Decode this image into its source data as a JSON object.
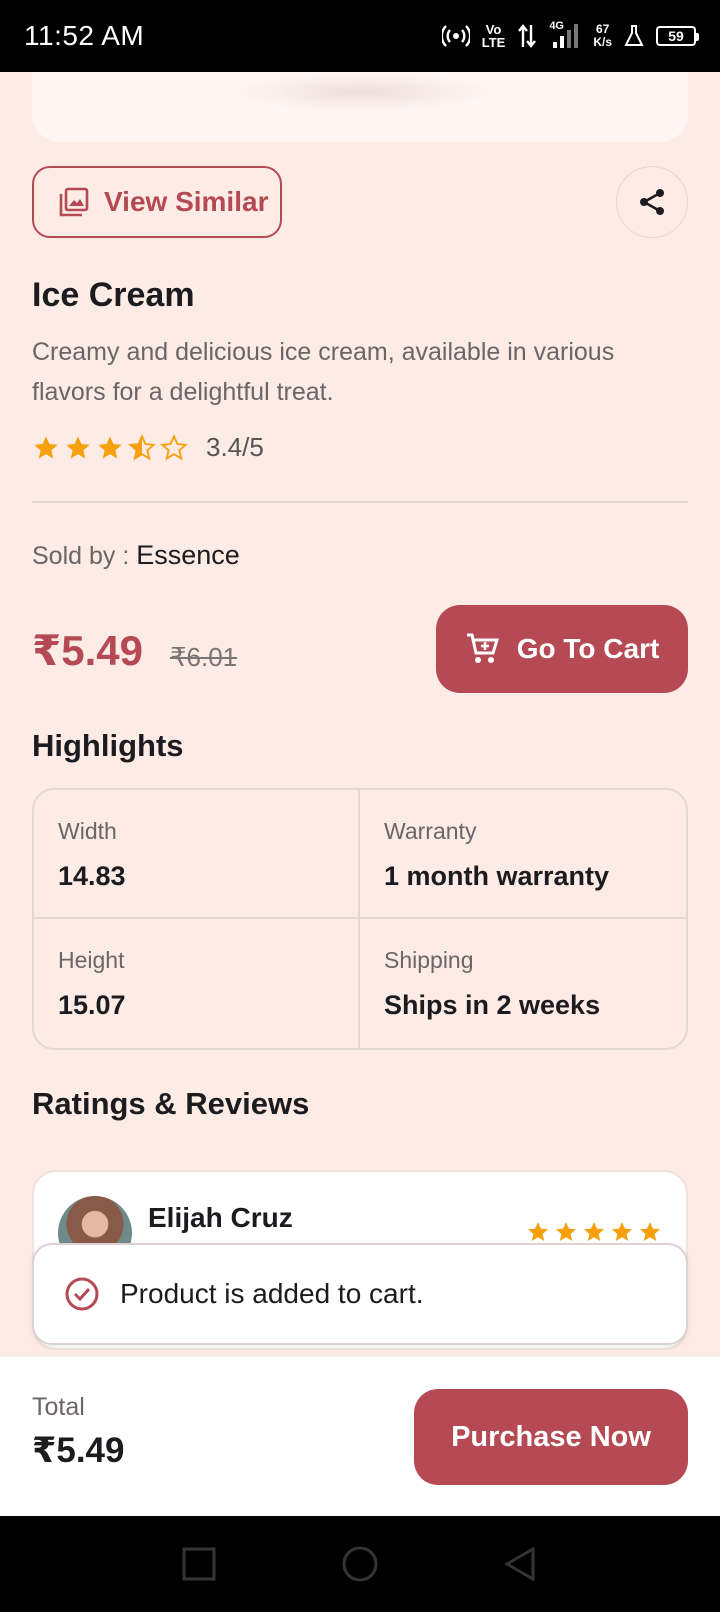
{
  "status_bar": {
    "time": "11:52 AM",
    "volte_text": "Vo\nLTE",
    "net_type": "4G",
    "speed_text": "67\nK/s",
    "battery": "59"
  },
  "actions": {
    "view_similar_label": "View Similar"
  },
  "product": {
    "title": "Ice Cream",
    "description": "Creamy and delicious ice cream, available in various flavors for a delightful treat.",
    "rating": 3.4,
    "rating_text": "3.4/5",
    "sold_by_label": "Sold by : ",
    "seller": "Essence",
    "price": "₹5.49",
    "mrp": "₹6.01",
    "go_to_cart_label": "Go To Cart"
  },
  "highlights": {
    "title": "Highlights",
    "items": [
      {
        "label": "Width",
        "value": "14.83"
      },
      {
        "label": "Warranty",
        "value": "1 month warranty"
      },
      {
        "label": "Height",
        "value": "15.07"
      },
      {
        "label": "Shipping",
        "value": "Ships in 2 weeks"
      }
    ]
  },
  "reviews": {
    "title": "Ratings & Reviews",
    "items": [
      {
        "name": "Elijah Cruz",
        "stars": 5
      }
    ]
  },
  "toast": {
    "message": "Product is added to cart."
  },
  "bottom_bar": {
    "total_label": "Total",
    "total_value": "₹5.49",
    "purchase_label": "Purchase Now"
  },
  "colors": {
    "accent": "#b54a55",
    "background": "#fdebe6",
    "star": "#f5a00c"
  }
}
